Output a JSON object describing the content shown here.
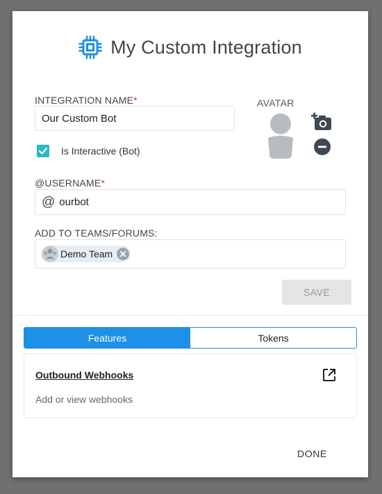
{
  "dialog": {
    "title": "My Custom Integration",
    "title_icon": "chip-icon"
  },
  "form": {
    "integration_name_label": "INTEGRATION NAME",
    "required_mark": "*",
    "integration_name_value": "Our Custom Bot",
    "is_interactive_label": "Is Interactive (Bot)",
    "is_interactive_checked": true,
    "username_label": "@USERNAME",
    "username_prefix": "@",
    "username_value": "ourbot",
    "teams_label": "ADD TO TEAMS/FORUMS:",
    "teams": [
      {
        "name": "Demo Team",
        "icon": "team-icon"
      }
    ],
    "save_label": "SAVE"
  },
  "avatar": {
    "label": "AVATAR",
    "add_icon": "add-photo-icon",
    "remove_icon": "remove-circle-icon"
  },
  "tabs": [
    {
      "label": "Features",
      "active": true
    },
    {
      "label": "Tokens",
      "active": false
    }
  ],
  "features": [
    {
      "title": "Outbound Webhooks",
      "description": "Add or view webhooks",
      "icon": "open-in-new-icon"
    }
  ],
  "footer": {
    "done_label": "DONE"
  },
  "colors": {
    "accent": "#1e90e6",
    "checkbox": "#2cb6c9",
    "title_icon": "#1e90e6",
    "required": "#c0392b"
  }
}
